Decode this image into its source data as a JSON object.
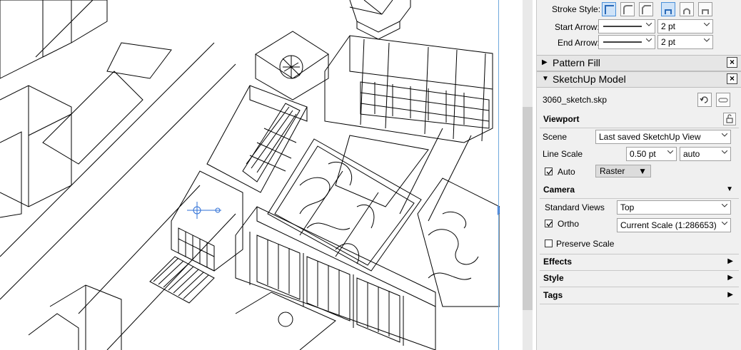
{
  "panel": {
    "stroke_style_label": "Stroke Style:",
    "start_arrow_label": "Start Arrow:",
    "start_arrow_size": "2 pt",
    "end_arrow_label": "End Arrow:",
    "end_arrow_size": "2 pt",
    "pattern_fill_title": "Pattern Fill",
    "sketchup_title": "SketchUp Model",
    "filename": "3060_sketch.skp",
    "viewport_title": "Viewport",
    "scene_label": "Scene",
    "scene_value": "Last saved SketchUp View",
    "line_scale_label": "Line Scale",
    "line_scale_value": "0.50 pt",
    "line_scale_mode": "auto",
    "auto_label": "Auto",
    "auto_checked": true,
    "render_mode": "Raster",
    "camera_title": "Camera",
    "standard_views_label": "Standard Views",
    "standard_views_value": "Top",
    "ortho_label": "Ortho",
    "ortho_checked": true,
    "ortho_scale": "Current Scale (1:286653)",
    "preserve_scale_label": "Preserve Scale",
    "preserve_scale_checked": false,
    "effects_title": "Effects",
    "style_title": "Style",
    "tags_title": "Tags"
  },
  "colors": {
    "panel_bg": "#f0f0f0",
    "accent_blue": "#4a90d9",
    "page_edge": "#6fa8dc"
  }
}
